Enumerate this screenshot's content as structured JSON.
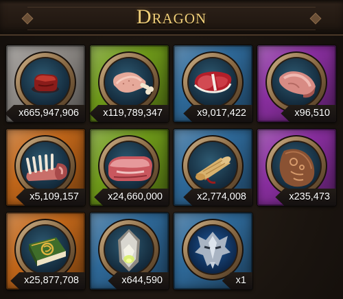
{
  "header": {
    "title": "Dragon"
  },
  "colors": {
    "gray": "#8e8a86",
    "green": "#6f9a1a",
    "blue": "#2f6a9a",
    "purple": "#8a2fa0",
    "orange": "#c2671a",
    "header_text": "#f0cf7a"
  },
  "items": [
    {
      "name": "raw-meat-chunk",
      "icon": "meat-chunk-icon",
      "rarity": "gray",
      "quantity": "x665,947,906"
    },
    {
      "name": "raw-drumstick",
      "icon": "drumstick-icon",
      "rarity": "green",
      "quantity": "x119,789,347"
    },
    {
      "name": "t-bone-steak",
      "icon": "steak-icon",
      "rarity": "blue",
      "quantity": "x9,017,422"
    },
    {
      "name": "leg-of-meat",
      "icon": "meat-leg-icon",
      "rarity": "purple",
      "quantity": "x96,510"
    },
    {
      "name": "rack-of-ribs",
      "icon": "ribs-icon",
      "rarity": "orange",
      "quantity": "x5,109,157"
    },
    {
      "name": "brisket-slab",
      "icon": "brisket-icon",
      "rarity": "green",
      "quantity": "x24,660,000"
    },
    {
      "name": "dragon-scroll",
      "icon": "scroll-icon",
      "rarity": "blue",
      "quantity": "x2,774,008"
    },
    {
      "name": "carved-stone-tablet",
      "icon": "stone-tablet-icon",
      "rarity": "purple",
      "quantity": "x235,473"
    },
    {
      "name": "dragon-tome",
      "icon": "book-icon",
      "rarity": "orange",
      "quantity": "x25,877,708"
    },
    {
      "name": "glowing-crystal",
      "icon": "crystal-icon",
      "rarity": "blue",
      "quantity": "x644,590"
    },
    {
      "name": "dragon-skull-emblem",
      "icon": "dragon-head-icon",
      "rarity": "blue",
      "quantity": "x1"
    }
  ]
}
